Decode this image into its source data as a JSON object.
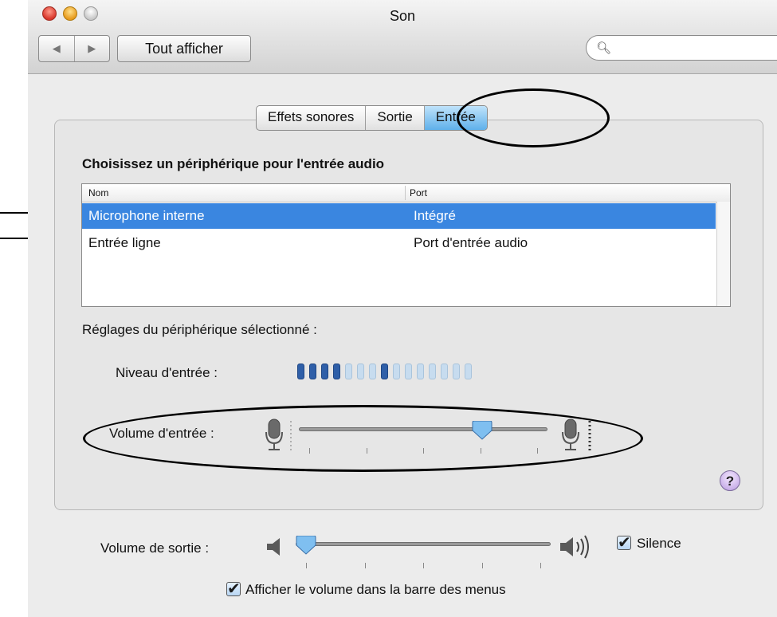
{
  "window": {
    "title": "Son",
    "show_all": "Tout afficher",
    "search_placeholder": ""
  },
  "tabs": [
    "Effets sonores",
    "Sortie",
    "Entrée"
  ],
  "selected_tab": "Entrée",
  "input": {
    "heading": "Choisissez un périphérique pour l'entrée audio",
    "columns": [
      "Nom",
      "Port"
    ],
    "devices": [
      {
        "name": "Microphone interne",
        "port": "Intégré",
        "selected": true
      },
      {
        "name": "Entrée ligne",
        "port": "Port d'entrée audio",
        "selected": false
      }
    ],
    "settings_label": "Réglages du périphérique sélectionné :",
    "level_label": "Niveau d'entrée :",
    "level_segments_total": 15,
    "level_segments_lit": 4,
    "volume_label": "Volume d'entrée :",
    "volume_fraction": 0.76
  },
  "output": {
    "volume_label": "Volume de sortie :",
    "volume_fraction": 0.0,
    "mute_label": "Silence",
    "mute_checked": true,
    "menu_label": "Afficher le volume dans la barre des menus",
    "menu_checked": true
  },
  "colors": {
    "selection": "#3a86e0",
    "tab_selected": "#5fb0ea",
    "level_on": "#2f5fa8",
    "level_off": "#c7dcef"
  },
  "icons": {
    "help": "?"
  }
}
